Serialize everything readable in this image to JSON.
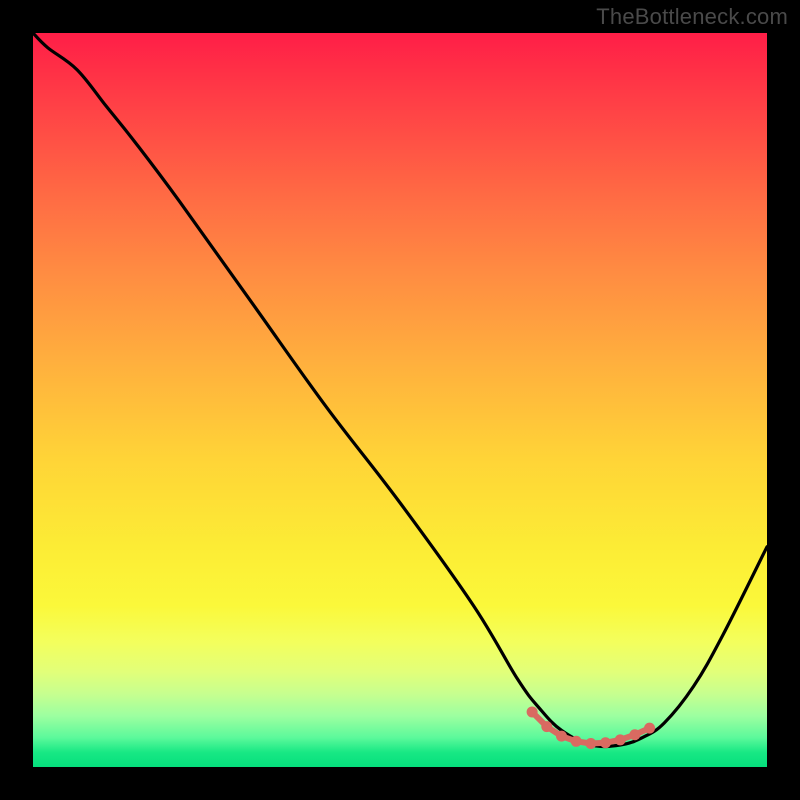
{
  "watermark": "TheBottleneck.com",
  "chart_data": {
    "type": "line",
    "title": "",
    "xlabel": "",
    "ylabel": "",
    "xlim": [
      0,
      100
    ],
    "ylim": [
      0,
      100
    ],
    "series": [
      {
        "name": "bottleneck-curve",
        "x": [
          0,
          2,
          6,
          10,
          14,
          20,
          30,
          40,
          50,
          60,
          66,
          69,
          72,
          76,
          80,
          83,
          86,
          90,
          94,
          100
        ],
        "values": [
          100,
          98,
          95,
          90,
          85,
          77,
          63,
          49,
          36,
          22,
          12,
          8,
          5,
          3,
          3,
          4,
          6,
          11,
          18,
          30
        ]
      }
    ],
    "annotations": [
      {
        "name": "valley-highlight",
        "type": "dotted-segment",
        "color": "#d96a61",
        "x": [
          68,
          70,
          72,
          74,
          76,
          78,
          80,
          82,
          84
        ],
        "values": [
          7.5,
          5.5,
          4.2,
          3.5,
          3.2,
          3.3,
          3.7,
          4.4,
          5.3
        ]
      }
    ],
    "background": {
      "type": "vertical-gradient",
      "stops": [
        "#ff1e47",
        "#ffad3e",
        "#fbf83a",
        "#05df7d"
      ]
    }
  }
}
